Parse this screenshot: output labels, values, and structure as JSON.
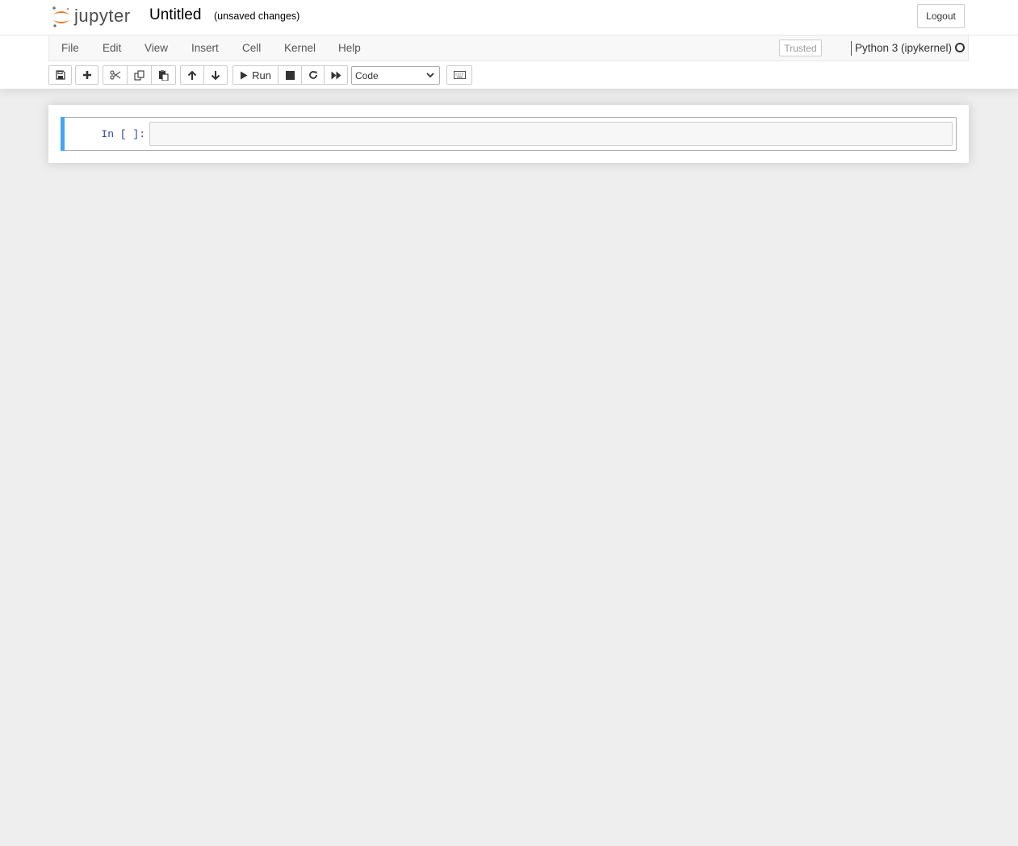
{
  "header": {
    "logo_text": "jupyter",
    "notebook_title": "Untitled",
    "save_status": "(unsaved changes)",
    "logout_label": "Logout"
  },
  "menubar": {
    "items": [
      {
        "label": "File"
      },
      {
        "label": "Edit"
      },
      {
        "label": "View"
      },
      {
        "label": "Insert"
      },
      {
        "label": "Cell"
      },
      {
        "label": "Kernel"
      },
      {
        "label": "Help"
      }
    ],
    "trusted_label": "Trusted",
    "kernel_name": "Python 3 (ipykernel)",
    "kernel_status": "idle"
  },
  "toolbar": {
    "buttons": [
      "save-icon",
      "plus-icon",
      "cut-icon",
      "copy-icon",
      "paste-icon",
      "arrow-up-icon",
      "arrow-down-icon",
      "play-icon",
      "stop-icon",
      "restart-icon",
      "fast-forward-icon",
      "keyboard-icon"
    ],
    "run_label": "Run",
    "cell_type": "Code"
  },
  "notebook": {
    "cells": [
      {
        "prompt": "In [ ]:",
        "source": ""
      }
    ]
  },
  "colors": {
    "background": "#eeeeee",
    "selected_cell_bar": "#42a5f5",
    "prompt_color": "#303f9f",
    "logo_orange": "#f37726"
  }
}
